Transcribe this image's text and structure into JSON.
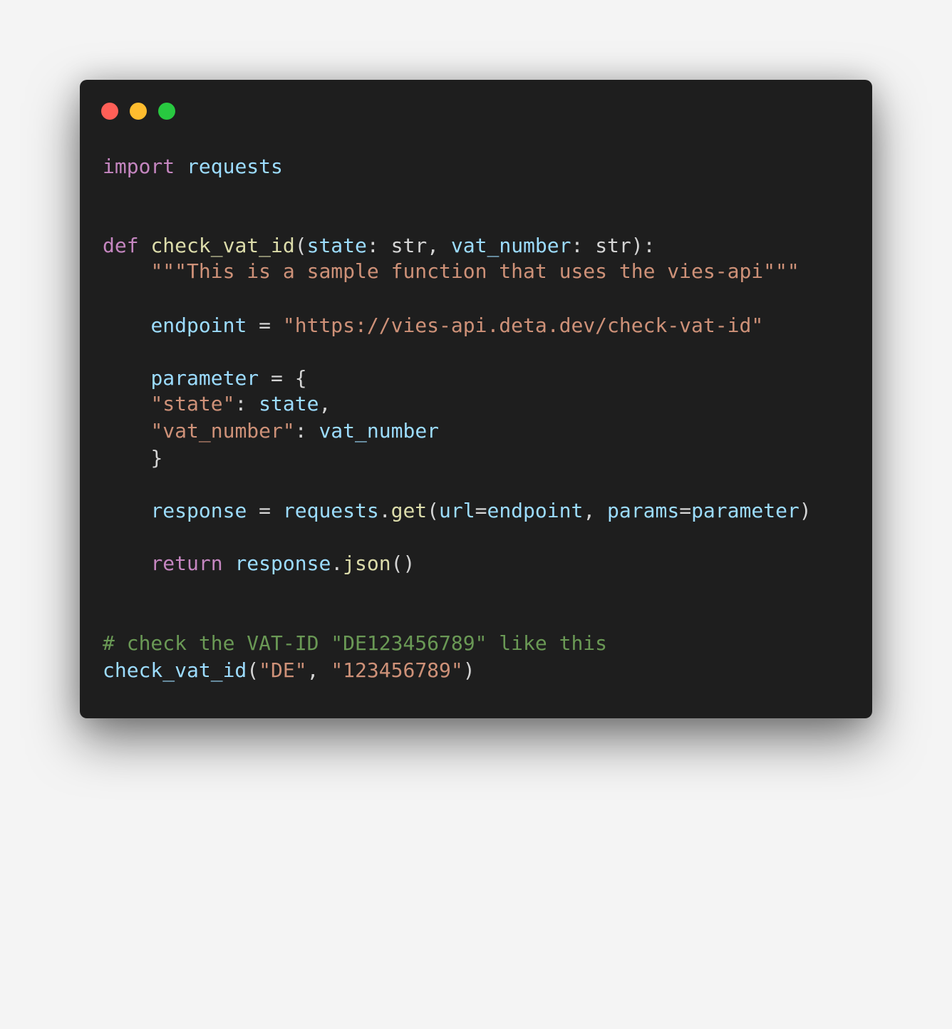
{
  "window": {
    "controls": [
      {
        "name": "close",
        "color": "#ff5f57"
      },
      {
        "name": "minimize",
        "color": "#febc2e"
      },
      {
        "name": "zoom",
        "color": "#28c840"
      }
    ]
  },
  "code": {
    "import_kw": "import",
    "import_mod": "requests",
    "def_kw": "def",
    "fn_name": "check_vat_id",
    "paren_open": "(",
    "param1": "state",
    "colon_type1": ": str, ",
    "param2": "vat_number",
    "colon_type2": ": str):",
    "docstring": "\"\"\"This is a sample function that uses the vies-api\"\"\"",
    "endpoint_var": "endpoint",
    "assign": " = ",
    "endpoint_val": "\"https://vies-api.deta.dev/check-vat-id\"",
    "parameter_var": "parameter",
    "brace_open": " = {",
    "key_state": "\"state\"",
    "colon_sep": ": ",
    "val_state": "state",
    "comma": ",",
    "key_vat": "\"vat_number\"",
    "val_vat": "vat_number",
    "brace_close": "}",
    "response_var": "response",
    "requests_mod": "requests",
    "dot": ".",
    "get_fn": "get",
    "url_kw": "url",
    "equals": "=",
    "endpoint_ref": "endpoint",
    "comma_space": ", ",
    "params_kw": "params",
    "parameter_ref": "parameter",
    "paren_close": ")",
    "return_kw": "return",
    "response_ref": "response",
    "json_fn": "json",
    "empty_call": "()",
    "comment": "# check the VAT-ID \"DE123456789\" like this",
    "call_fn": "check_vat_id",
    "call_arg1": "\"DE\"",
    "call_arg2": "\"123456789\""
  }
}
